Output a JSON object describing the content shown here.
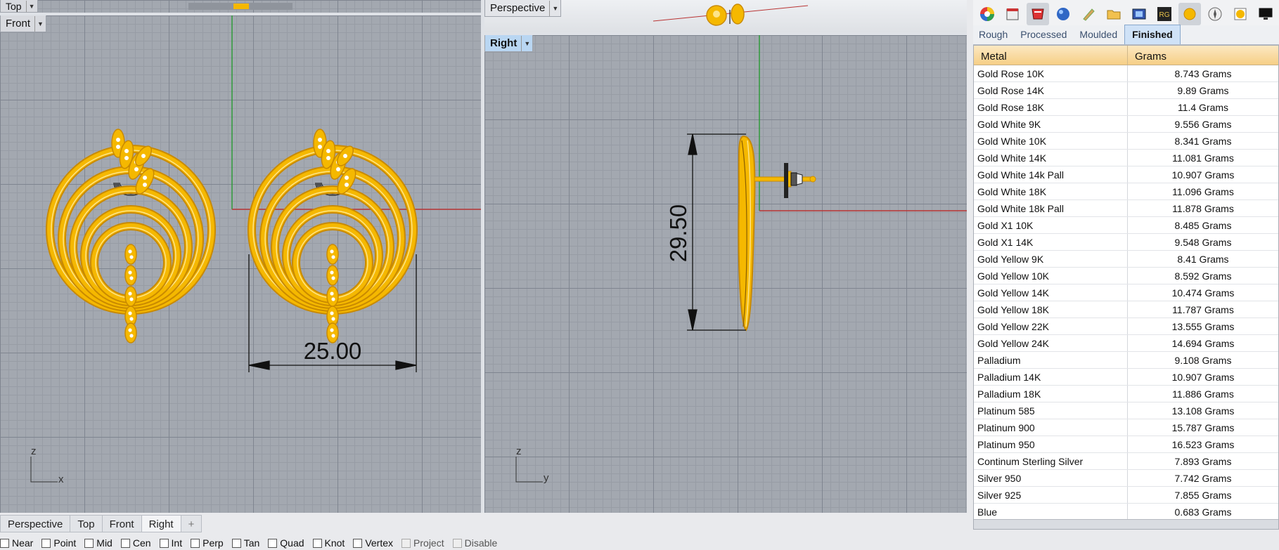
{
  "viewports": {
    "top_label": "Top",
    "front_label": "Front",
    "perspective_label": "Perspective",
    "right_label": "Right",
    "front_axes": {
      "vertical": "z",
      "horizontal": "x"
    },
    "right_axes": {
      "vertical": "z",
      "horizontal": "y"
    },
    "front_dimension": "25.00",
    "right_dimension": "29.50"
  },
  "panel": {
    "toolbar_icons": [
      "color-wheel-icon",
      "cabinet-icon",
      "material-icon",
      "globe-icon",
      "brush-icon",
      "folder-icon",
      "camera-icon",
      "rg-icon",
      "gold-icon",
      "compass-icon",
      "gold-layers-icon",
      "monitor-icon"
    ],
    "tabs": [
      "Rough",
      "Processed",
      "Moulded",
      "Finished"
    ],
    "active_tab": "Finished",
    "columns": [
      "Metal",
      "Grams"
    ],
    "rows": [
      [
        "Gold Rose 10K",
        "8.743 Grams"
      ],
      [
        "Gold Rose 14K",
        "9.89 Grams"
      ],
      [
        "Gold Rose 18K",
        "11.4 Grams"
      ],
      [
        "Gold White 9K",
        "9.556 Grams"
      ],
      [
        "Gold White 10K",
        "8.341 Grams"
      ],
      [
        "Gold White 14K",
        "11.081 Grams"
      ],
      [
        "Gold White 14k Pall",
        "10.907 Grams"
      ],
      [
        "Gold White 18K",
        "11.096 Grams"
      ],
      [
        "Gold White 18k Pall",
        "11.878 Grams"
      ],
      [
        "Gold X1 10K",
        "8.485 Grams"
      ],
      [
        "Gold X1 14K",
        "9.548 Grams"
      ],
      [
        "Gold Yellow 9K",
        "8.41 Grams"
      ],
      [
        "Gold Yellow 10K",
        "8.592 Grams"
      ],
      [
        "Gold Yellow 14K",
        "10.474 Grams"
      ],
      [
        "Gold Yellow 18K",
        "11.787 Grams"
      ],
      [
        "Gold Yellow 22K",
        "13.555 Grams"
      ],
      [
        "Gold Yellow 24K",
        "14.694 Grams"
      ],
      [
        "Palladium",
        "9.108 Grams"
      ],
      [
        "Palladium 14K",
        "10.907 Grams"
      ],
      [
        "Palladium 18K",
        "11.886 Grams"
      ],
      [
        "Platinum 585",
        "13.108 Grams"
      ],
      [
        "Platinum 900",
        "15.787 Grams"
      ],
      [
        "Platinum 950",
        "16.523 Grams"
      ],
      [
        "Continum Sterling Silver",
        "7.893 Grams"
      ],
      [
        "Silver 950",
        "7.742 Grams"
      ],
      [
        "Silver 925",
        "7.855 Grams"
      ],
      [
        "Blue",
        "0.683 Grams"
      ]
    ]
  },
  "bottom_tabs": [
    "Perspective",
    "Top",
    "Front",
    "Right"
  ],
  "active_bottom_tab": "Right",
  "add_tab_label": "+",
  "osnaps": [
    {
      "label": "Near",
      "enabled": true
    },
    {
      "label": "Point",
      "enabled": true
    },
    {
      "label": "Mid",
      "enabled": true
    },
    {
      "label": "Cen",
      "enabled": true
    },
    {
      "label": "Int",
      "enabled": true
    },
    {
      "label": "Perp",
      "enabled": true
    },
    {
      "label": "Tan",
      "enabled": true
    },
    {
      "label": "Quad",
      "enabled": true
    },
    {
      "label": "Knot",
      "enabled": true
    },
    {
      "label": "Vertex",
      "enabled": true
    },
    {
      "label": "Project",
      "enabled": false
    },
    {
      "label": "Disable",
      "enabled": false
    }
  ],
  "colors": {
    "gold": "#f5b800",
    "gold_dark": "#c98a00",
    "x_axis": "#b93434",
    "y_axis": "#2f9a3a",
    "header": "#f6cf86",
    "active_tab": "#cfe2f7"
  }
}
